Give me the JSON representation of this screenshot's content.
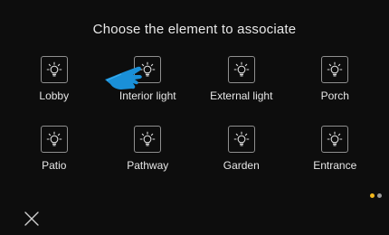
{
  "title": "Choose the element to associate",
  "icon_name": "light-bulb-icon",
  "items": [
    {
      "label": "Lobby"
    },
    {
      "label": "Interior light"
    },
    {
      "label": "External light"
    },
    {
      "label": "Porch"
    },
    {
      "label": "Patio"
    },
    {
      "label": "Pathway"
    },
    {
      "label": "Garden"
    },
    {
      "label": "Entrance"
    }
  ],
  "pagination": {
    "pages": 2,
    "current": 1
  },
  "colors": {
    "background": "#0d0d0d",
    "accent_pointer": "#1a90d8",
    "active_dot": "#f3b81c",
    "inactive_dot": "#9a9a9a"
  }
}
